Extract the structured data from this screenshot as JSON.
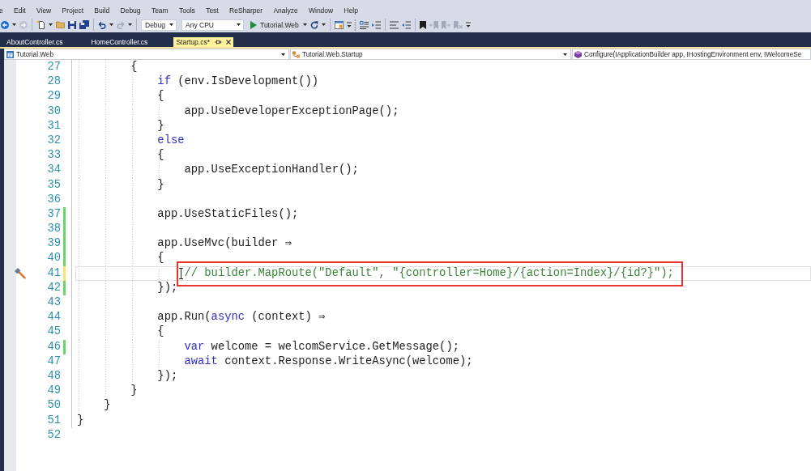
{
  "menu_bar": {
    "items": [
      "e",
      "Edit",
      "View",
      "Project",
      "Build",
      "Debug",
      "Team",
      "Tools",
      "Test",
      "ReSharper",
      "Analyze",
      "Window",
      "Help"
    ]
  },
  "toolbar": {
    "groups": [
      {
        "items": [
          {
            "kind": "back",
            "disabled": false,
            "menu": true
          },
          {
            "kind": "forward",
            "disabled": true,
            "menu": false
          }
        ]
      },
      {
        "items": [
          {
            "kind": "newfile",
            "disabled": false,
            "menu": true
          },
          {
            "kind": "open",
            "disabled": false,
            "menu": false
          },
          {
            "kind": "save",
            "disabled": false,
            "menu": false
          },
          {
            "kind": "saveall",
            "disabled": false,
            "menu": false
          }
        ]
      },
      {
        "items": [
          {
            "kind": "undo",
            "disabled": false,
            "menu": true
          },
          {
            "kind": "redo",
            "disabled": true,
            "menu": true
          }
        ]
      },
      {
        "items": [
          {
            "kind": "dropdown",
            "value": "Debug"
          },
          {
            "kind": "dropdown",
            "value": "Any CPU"
          },
          {
            "kind": "start",
            "label": "Tutorial.Web",
            "menu": true
          },
          {
            "kind": "refresh",
            "disabled": false,
            "menu": true
          }
        ]
      },
      {
        "items": [
          {
            "kind": "browse",
            "disabled": false,
            "menu": false
          },
          {
            "kind": "overflow"
          }
        ]
      },
      {
        "items": [
          {
            "kind": "grip"
          },
          {
            "kind": "list",
            "disabled": false,
            "menu": false
          },
          {
            "kind": "indent",
            "disabled": false,
            "menu": false
          }
        ]
      },
      {
        "items": [
          {
            "kind": "lines",
            "disabled": false,
            "menu": false
          },
          {
            "kind": "outdent",
            "disabled": false,
            "menu": false
          }
        ]
      },
      {
        "items": [
          {
            "kind": "bookmark",
            "disabled": false,
            "menu": false
          },
          {
            "kind": "bookmarkprev",
            "disabled": true,
            "menu": false
          },
          {
            "kind": "bookmarknext",
            "disabled": true,
            "menu": false
          },
          {
            "kind": "bookmarkclear",
            "disabled": true,
            "menu": false
          },
          {
            "kind": "overflow"
          }
        ]
      }
    ]
  },
  "tabs": [
    {
      "label": "AboutController.cs",
      "selected": false
    },
    {
      "label": "HomeController.cs",
      "selected": false
    },
    {
      "label": "Startup.cs*",
      "selected": true
    }
  ],
  "navigation_bar": {
    "project": "Tutorial.Web",
    "type": "Tutorial.Web.Startup",
    "member": "Configure(IApplicationBuilder app, IHostingEnvironment env, IWelcomeSe"
  },
  "editor": {
    "lines": [
      {
        "number": "27",
        "code": [
          {
            "kind": "plain",
            "text": "        {"
          }
        ],
        "current": false,
        "highlighted": false,
        "action": false,
        "pointer": false
      },
      {
        "number": "28",
        "code": [
          {
            "kind": "keyword",
            "text": "            if"
          },
          {
            "kind": "plain",
            "text": " (env.IsDevelopment())"
          }
        ],
        "current": false,
        "highlighted": false,
        "action": false,
        "pointer": false
      },
      {
        "number": "29",
        "code": [
          {
            "kind": "plain",
            "text": "            {"
          }
        ],
        "current": false,
        "highlighted": false,
        "action": false,
        "pointer": false
      },
      {
        "number": "30",
        "code": [
          {
            "kind": "plain",
            "text": "                app.UseDeveloperExceptionPage();"
          }
        ],
        "current": false,
        "highlighted": false,
        "action": false,
        "pointer": false
      },
      {
        "number": "31",
        "code": [
          {
            "kind": "plain",
            "text": "            }"
          }
        ],
        "current": false,
        "highlighted": false,
        "action": false,
        "pointer": false
      },
      {
        "number": "32",
        "code": [
          {
            "kind": "keyword",
            "text": "            else"
          }
        ],
        "current": false,
        "highlighted": false,
        "action": false,
        "pointer": false
      },
      {
        "number": "33",
        "code": [
          {
            "kind": "plain",
            "text": "            {"
          }
        ],
        "current": false,
        "highlighted": false,
        "action": false,
        "pointer": false
      },
      {
        "number": "34",
        "code": [
          {
            "kind": "plain",
            "text": "                app.UseExceptionHandler();"
          }
        ],
        "current": false,
        "highlighted": false,
        "action": false,
        "pointer": false
      },
      {
        "number": "35",
        "code": [
          {
            "kind": "plain",
            "text": "            }"
          }
        ],
        "current": false,
        "highlighted": false,
        "action": false,
        "pointer": false
      },
      {
        "number": "36",
        "current": false,
        "highlighted": false,
        "action": false,
        "pointer": false
      },
      {
        "number": "37",
        "code": [
          {
            "kind": "plain",
            "text": "            app.UseStaticFiles();"
          }
        ],
        "color": "#6bd36b",
        "current": false,
        "highlighted": false,
        "action": false,
        "pointer": false
      },
      {
        "number": "38",
        "color": "#6bd36b",
        "current": false,
        "highlighted": false,
        "action": false,
        "pointer": false
      },
      {
        "number": "39",
        "code": [
          {
            "kind": "plain",
            "text": "            app.UseMvc(builder ⇒"
          }
        ],
        "color": "#6bd36b",
        "current": false,
        "highlighted": false,
        "action": false,
        "pointer": false
      },
      {
        "number": "40",
        "code": [
          {
            "kind": "plain",
            "text": "            {"
          }
        ],
        "color": "#6bd36b",
        "current": false,
        "highlighted": false,
        "action": false,
        "pointer": false
      },
      {
        "number": "41",
        "code": [
          {
            "kind": "comment",
            "text": "                // builder.MapRoute(\"Default\", \"{controller=Home}/{action=Index}/{id?}\");"
          }
        ],
        "color": "#f5e66b",
        "current": true,
        "highlighted": true,
        "action": true,
        "pointer": true
      },
      {
        "number": "42",
        "code": [
          {
            "kind": "plain",
            "text": "            });"
          }
        ],
        "color": "#6bd36b",
        "current": false,
        "highlighted": false,
        "action": false,
        "pointer": false
      },
      {
        "number": "43",
        "current": false,
        "highlighted": false,
        "action": false,
        "pointer": false
      },
      {
        "number": "44",
        "code": [
          {
            "kind": "plain",
            "text": "            app.Run("
          },
          {
            "kind": "keyword",
            "text": "async"
          },
          {
            "kind": "plain",
            "text": " (context) ⇒"
          }
        ],
        "current": false,
        "highlighted": false,
        "action": false,
        "pointer": false
      },
      {
        "number": "45",
        "code": [
          {
            "kind": "plain",
            "text": "            {"
          }
        ],
        "current": false,
        "highlighted": false,
        "action": false,
        "pointer": false
      },
      {
        "number": "46",
        "code": [
          {
            "kind": "keyword",
            "text": "                var"
          },
          {
            "kind": "plain",
            "text": " welcome = welcomService.GetMessage();"
          }
        ],
        "color": "#6bd36b",
        "current": false,
        "highlighted": false,
        "action": false,
        "pointer": false
      },
      {
        "number": "47",
        "code": [
          {
            "kind": "keyword",
            "text": "                await"
          },
          {
            "kind": "plain",
            "text": " context.Response.WriteAsync(welcome);"
          }
        ],
        "current": false,
        "highlighted": false,
        "action": false,
        "pointer": false
      },
      {
        "number": "48",
        "code": [
          {
            "kind": "plain",
            "text": "            });"
          }
        ],
        "current": false,
        "highlighted": false,
        "action": false,
        "pointer": false
      },
      {
        "number": "49",
        "code": [
          {
            "kind": "plain",
            "text": "        }"
          }
        ],
        "current": false,
        "highlighted": false,
        "action": false,
        "pointer": false
      },
      {
        "number": "50",
        "code": [
          {
            "kind": "plain",
            "text": "    }"
          }
        ],
        "current": false,
        "highlighted": false,
        "action": false,
        "pointer": false
      },
      {
        "number": "51",
        "code": [
          {
            "kind": "plain",
            "text": "}"
          }
        ],
        "current": false,
        "highlighted": false,
        "action": false,
        "pointer": false
      },
      {
        "number": "52",
        "current": false,
        "highlighted": false,
        "action": false,
        "pointer": false
      }
    ]
  }
}
